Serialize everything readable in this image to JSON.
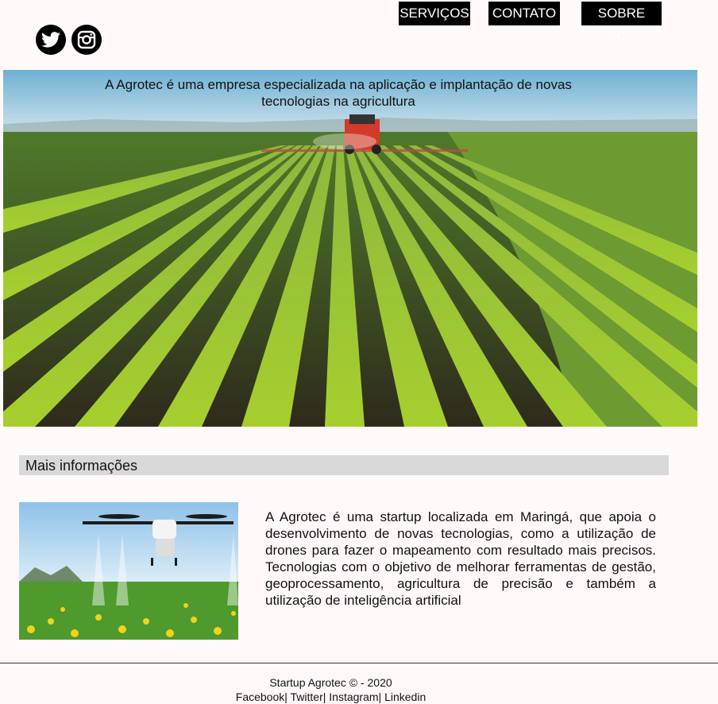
{
  "nav": {
    "items": [
      {
        "label": "SERVIÇOS"
      },
      {
        "label": "CONTATO"
      },
      {
        "label": "SOBRE NÓS"
      }
    ]
  },
  "social": {
    "icons": [
      "twitter-icon",
      "instagram-icon"
    ]
  },
  "hero": {
    "text": "A Agrotec é uma empresa especializada na aplicação e implantação de novas tecnologias na agricultura"
  },
  "info": {
    "title": "Mais informações",
    "body": " A Agrotec é uma startup localizada em Maringá, que apoia o desenvolvimento de novas tecnologias, como a utilização de drones para fazer o mapeamento com resultado mais precisos. Tecnologias com o objetivo de melhorar ferramentas de gestão, geoprocessamento, agricultura de precisão e também a utilização de inteligência artificial"
  },
  "footer": {
    "copyright": "Startup Agrotec © - 2020",
    "links": [
      {
        "label": "Facebook"
      },
      {
        "label": "Twitter"
      },
      {
        "label": "Instagram"
      },
      {
        "label": "Linkedin"
      }
    ]
  },
  "colors": {
    "background": "#fffaf9",
    "nav_bg": "#000000",
    "section_bar": "#d9d9d9"
  }
}
